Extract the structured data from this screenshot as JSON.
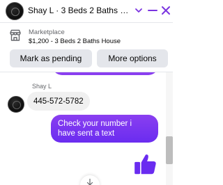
{
  "header": {
    "title": "Shay L · 3 Beds 2 Baths Ho...",
    "icons": [
      "chevron-down-icon",
      "minimize-icon",
      "close-icon"
    ],
    "accent_color": "#7a33e0"
  },
  "listing": {
    "source": "Marketplace",
    "summary": "$1,200 - 3 Beds 2 Baths House"
  },
  "actions": {
    "mark_pending": "Mark as pending",
    "more_options": "More options"
  },
  "chat": {
    "sender_name": "Shay L",
    "incoming_message": "445-572-5782",
    "outgoing_message": "Check your number i have sent a text",
    "outgoing_color": "#7b36f0",
    "reaction_icon": "thumbs-up-icon",
    "scroll_icon": "arrow-down-icon"
  }
}
